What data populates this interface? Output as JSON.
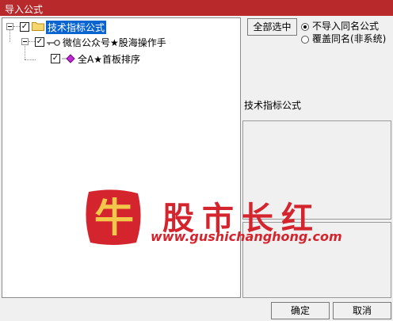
{
  "window": {
    "title": "导入公式"
  },
  "tree": {
    "root": {
      "label": "技术指标公式",
      "checked": true,
      "expanded": true
    },
    "group": {
      "label": "微信公众号★股海操作手",
      "checked": true,
      "expanded": true
    },
    "item": {
      "label": "全A★首板排序",
      "checked": true
    }
  },
  "options": {
    "select_all_label": "全部选中",
    "radio_no_import": "不导入同名公式",
    "radio_overwrite": "覆盖同名(非系统)",
    "selected_radio": "no_import"
  },
  "info": {
    "header": "技术指标公式"
  },
  "footer": {
    "ok_label": "确定",
    "cancel_label": "取消"
  },
  "watermark": {
    "logo_text": "牛",
    "brand_text": "股市长红",
    "url": "www.gushichanghong.com"
  },
  "colors": {
    "title_bar": "#b8292c",
    "selection": "#0a64d0",
    "watermark": "#d4252f"
  }
}
